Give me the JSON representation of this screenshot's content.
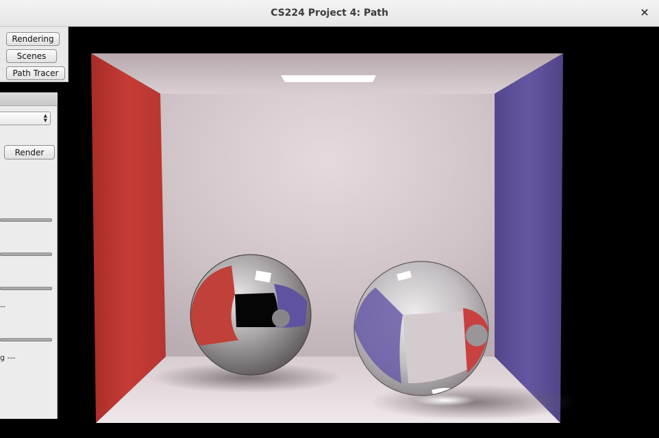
{
  "window": {
    "title": "CS224 Project 4: Path",
    "close_glyph": "×"
  },
  "tabs": {
    "rendering": "Rendering",
    "scenes": "Scenes",
    "path_tracer": "Path Tracer"
  },
  "side_panel": {
    "render_label": "Render",
    "status_line_1": "--",
    "status_line_2": "g ---",
    "dropdown_icon": "up-down-arrows-icon"
  },
  "scene": {
    "description_icon": "cornell-box-render",
    "colors": {
      "left_wall": "#c23a35",
      "right_wall": "#5d4f9c",
      "back_wall": "#d6cccf",
      "floor": "#e8e0e2",
      "light": "#ffffff"
    }
  }
}
